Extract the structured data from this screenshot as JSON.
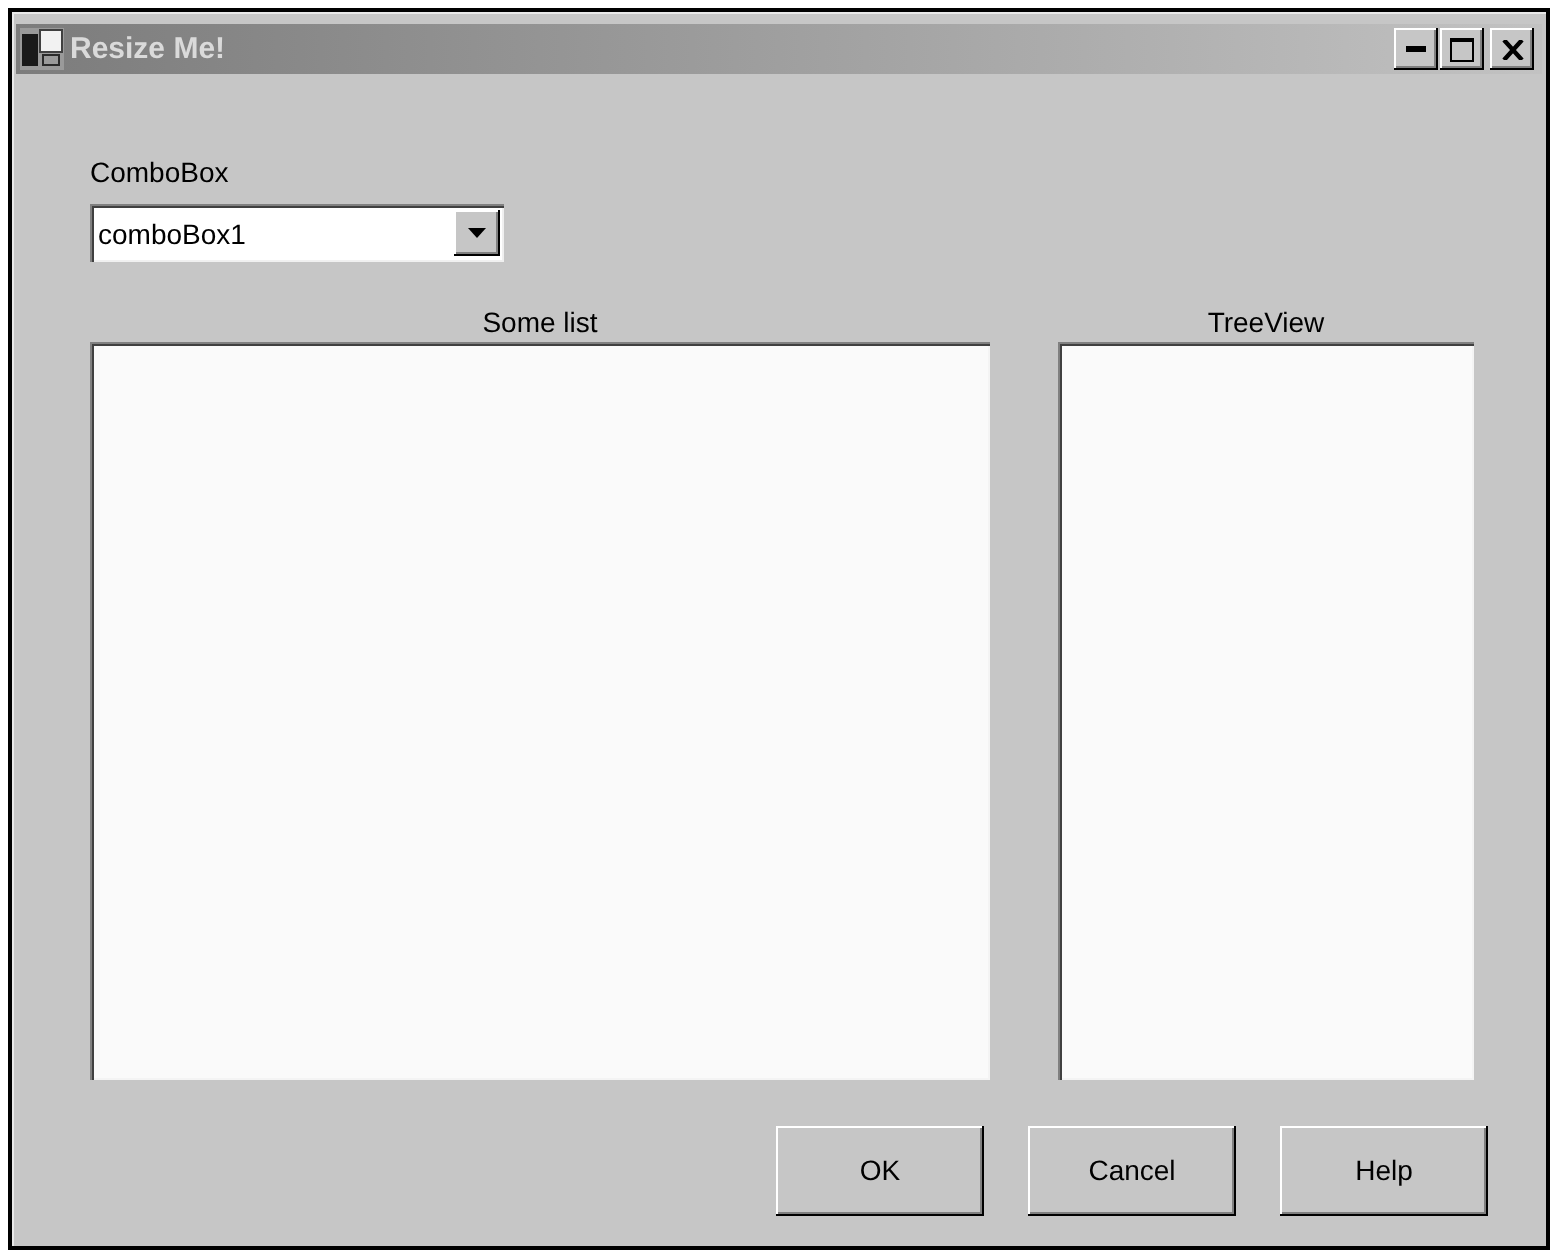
{
  "window": {
    "title": "Resize Me!"
  },
  "combo_box": {
    "label": "ComboBox",
    "value": "comboBox1"
  },
  "panels": [
    {
      "label": "Some list"
    },
    {
      "label": "TreeView"
    }
  ],
  "buttons": [
    "OK",
    "Cancel",
    "Help"
  ]
}
